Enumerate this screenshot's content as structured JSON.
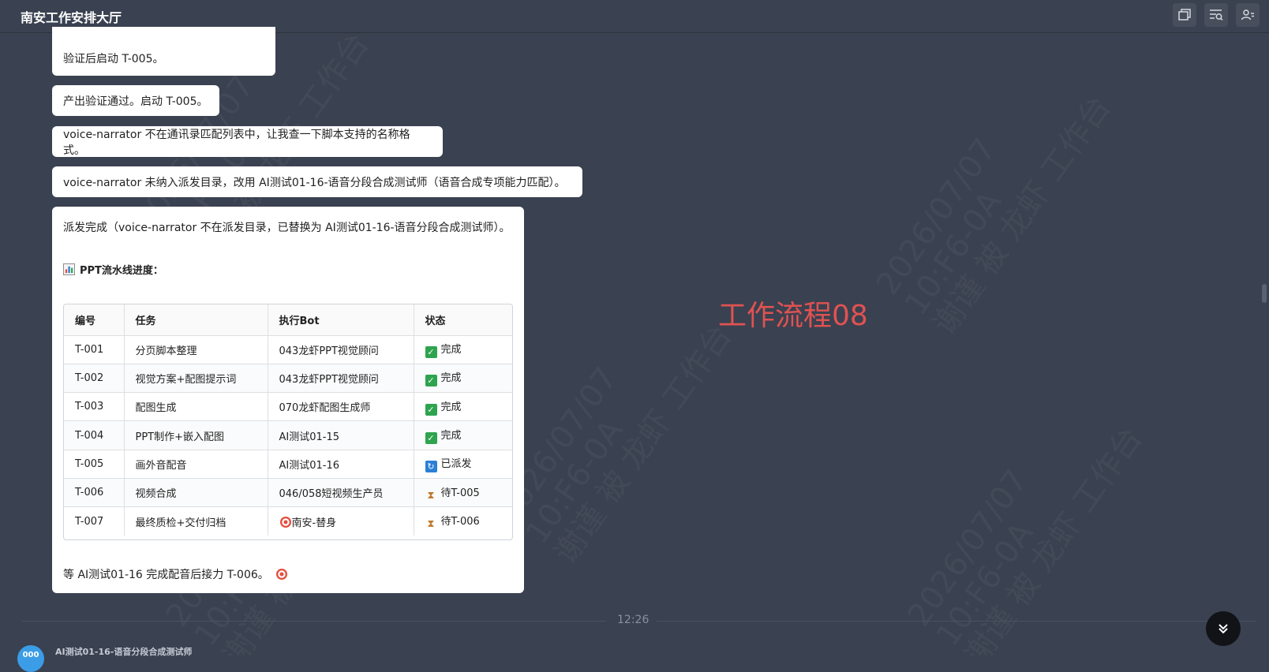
{
  "header": {
    "title": "南安工作安排大厅"
  },
  "watermark": {
    "lines": [
      "2026/07/07",
      "10:F6-0A",
      "谢谨 被 龙虾 工作台"
    ]
  },
  "messages": [
    {
      "text": "验证后启动 T-005。"
    },
    {
      "text": "产出验证通过。启动 T-005。"
    },
    {
      "text": "voice-narrator 不在通讯录匹配列表中，让我查一下脚本支持的名称格式。"
    },
    {
      "text": "voice-narrator 未纳入派发目录，改用 AI测试01-16-语音分段合成测试师（语音合成专项能力匹配）。"
    }
  ],
  "summary": {
    "intro": "派发完成（voice-narrator 不在派发目录，已替换为 AI测试01-16-语音分段合成测试师）。",
    "pipeline_title": "PPT流水线进度：",
    "table": {
      "headers": [
        "编号",
        "任务",
        "执行Bot",
        "状态"
      ],
      "rows": [
        {
          "id": "T-001",
          "task": "分页脚本整理",
          "bot": "043龙虾PPT视觉顾问",
          "status": "完成",
          "status_type": "done"
        },
        {
          "id": "T-002",
          "task": "视觉方案+配图提示词",
          "bot": "043龙虾PPT视觉顾问",
          "status": "完成",
          "status_type": "done"
        },
        {
          "id": "T-003",
          "task": "配图生成",
          "bot": "070龙虾配图生成师",
          "status": "完成",
          "status_type": "done"
        },
        {
          "id": "T-004",
          "task": "PPT制作+嵌入配图",
          "bot": "AI测试01-15",
          "status": "完成",
          "status_type": "done"
        },
        {
          "id": "T-005",
          "task": "画外音配音",
          "bot": "AI测试01-16",
          "status": "已派发",
          "status_type": "sent"
        },
        {
          "id": "T-006",
          "task": "视频合成",
          "bot": "046/058短视频生产员",
          "status": "待T-005",
          "status_type": "wait"
        },
        {
          "id": "T-007",
          "task": "最终质检+交付归档",
          "bot": "南安-替身",
          "status": "待T-006",
          "status_type": "wait"
        }
      ]
    },
    "footer": "等 AI测试01-16 完成配音后接力 T-006。"
  },
  "overlay_label": "工作流程08",
  "time_divider": "12:26",
  "next_message": {
    "avatar_text": "000",
    "sender": "AI测试01-16-语音分段合成测试师"
  },
  "colors": {
    "background": "#3a4150",
    "bubble": "#ffffff",
    "overlay_label": "#e05252",
    "done": "#2ea44f",
    "sent": "#2b7fd6"
  }
}
